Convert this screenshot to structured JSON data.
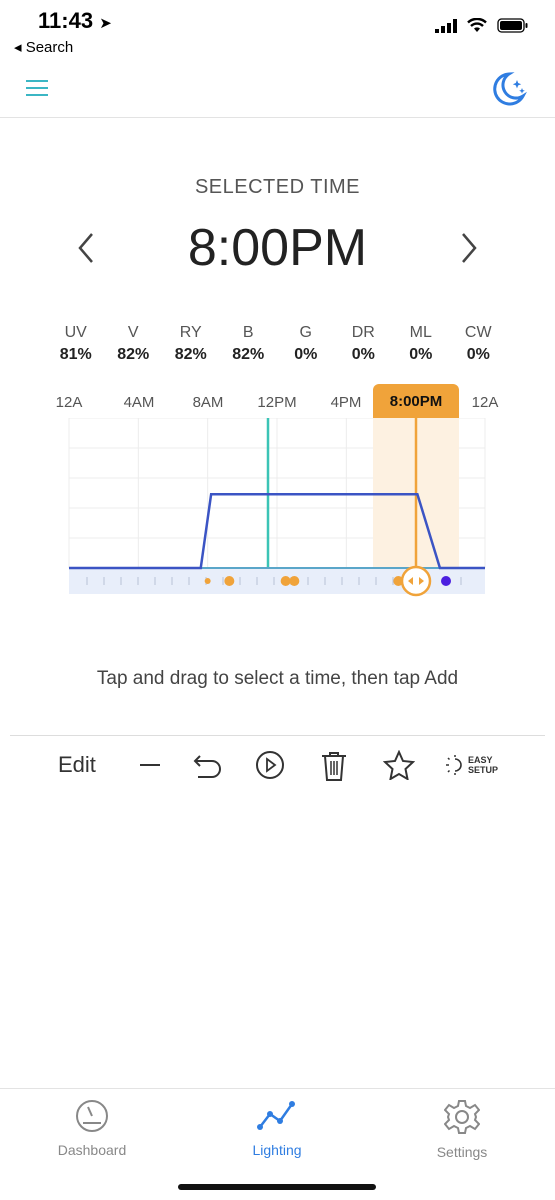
{
  "status": {
    "time": "11:43",
    "back": "Search"
  },
  "nav": {
    "menu_icon": "hamburger-icon",
    "moon_icon": "moon-stars-icon",
    "accent": "#3bb6c4",
    "moon_color": "#2f7de1"
  },
  "selected": {
    "label": "SELECTED TIME",
    "time": "8:00PM"
  },
  "channels": [
    {
      "name": "UV",
      "value": "81%"
    },
    {
      "name": "V",
      "value": "82%"
    },
    {
      "name": "RY",
      "value": "82%"
    },
    {
      "name": "B",
      "value": "82%"
    },
    {
      "name": "G",
      "value": "0%"
    },
    {
      "name": "DR",
      "value": "0%"
    },
    {
      "name": "ML",
      "value": "0%"
    },
    {
      "name": "CW",
      "value": "0%"
    }
  ],
  "axis": {
    "ticks": [
      "12A",
      "4AM",
      "8AM",
      "12PM",
      "4PM",
      "12A"
    ],
    "active": "8:00PM"
  },
  "chart_data": {
    "type": "line",
    "series": [
      {
        "values": [
          0,
          0,
          0,
          0,
          82,
          82,
          82,
          82,
          0,
          0
        ]
      }
    ],
    "x_hours": [
      0,
      4,
      8,
      15.2,
      16.4,
      24,
      32,
      40.2,
      42.8,
      48
    ],
    "ylim": [
      0,
      100
    ],
    "current_time": "12PM",
    "selected_time": "8:00PM",
    "colors": {
      "line": "#3b54c4",
      "now": "#3bc4b6",
      "selected": "#f0a33a",
      "highlight": "#fdf1e1"
    }
  },
  "hint": "Tap and drag to select a time, then tap Add",
  "toolbar": {
    "edit": "Edit",
    "easy_1": "EASY",
    "easy_2": "SETUP"
  },
  "tabs": [
    {
      "label": "Dashboard",
      "icon": "gauge-icon"
    },
    {
      "label": "Lighting",
      "icon": "chart-line-icon",
      "active": true
    },
    {
      "label": "Settings",
      "icon": "gear-icon"
    }
  ]
}
